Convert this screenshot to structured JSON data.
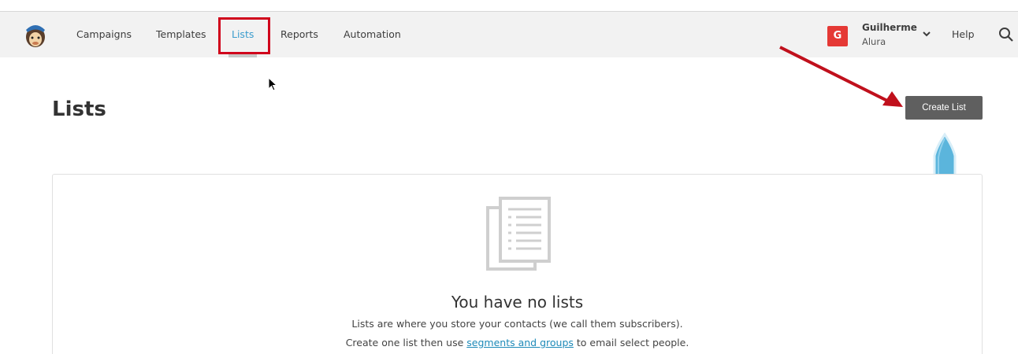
{
  "nav": {
    "items": [
      {
        "label": "Campaigns"
      },
      {
        "label": "Templates"
      },
      {
        "label": "Lists",
        "active": true
      },
      {
        "label": "Reports"
      },
      {
        "label": "Automation"
      }
    ],
    "user": {
      "initial": "G",
      "name": "Guilherme",
      "org": "Alura"
    },
    "help_label": "Help"
  },
  "page": {
    "title": "Lists",
    "create_button_label": "Create List"
  },
  "empty_state": {
    "title": "You have no lists",
    "description": "Lists are where you store your contacts (we call them subscribers).",
    "line2_prefix": "Create one list then use ",
    "line2_link": "segments and groups",
    "line2_suffix": " to email select people."
  },
  "colors": {
    "accent": "#3a9ccd",
    "annotation": "#d0021b",
    "avatar": "#e53935",
    "button": "#5f5f5f"
  }
}
